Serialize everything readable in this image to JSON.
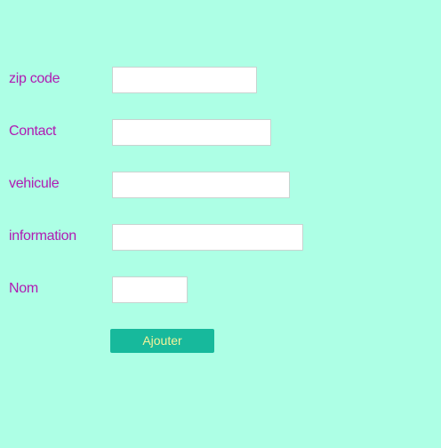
{
  "form": {
    "fields": [
      {
        "label": "zip code",
        "value": "",
        "placeholder": ""
      },
      {
        "label": "Contact",
        "value": "",
        "placeholder": ""
      },
      {
        "label": "vehicule",
        "value": "",
        "placeholder": ""
      },
      {
        "label": "information",
        "value": "",
        "placeholder": ""
      },
      {
        "label": "Nom",
        "value": "",
        "placeholder": ""
      }
    ],
    "submit_label": "Ajouter"
  },
  "colors": {
    "background": "#adffe5",
    "label": "#b01ab2",
    "button": "#17b99c",
    "button_text": "#f3f39a"
  }
}
